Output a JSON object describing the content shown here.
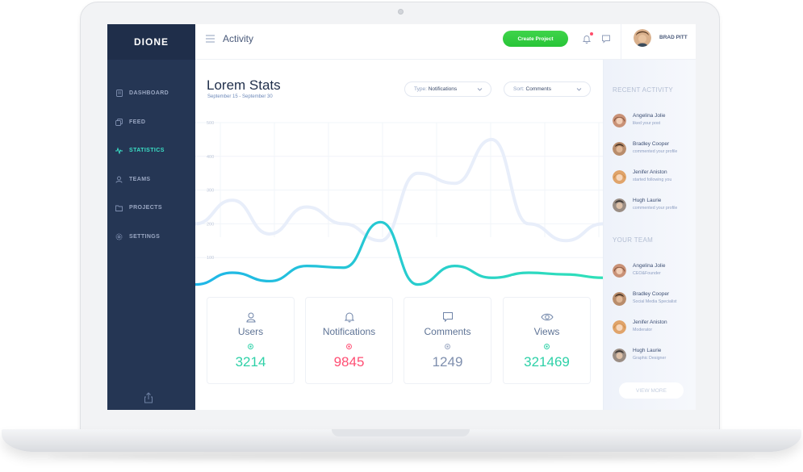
{
  "brand": {
    "name": "DIONE"
  },
  "sidebar": {
    "items": [
      {
        "label": "DASHBOARD",
        "icon": "file-icon",
        "active": false
      },
      {
        "label": "FEED",
        "icon": "copy-icon",
        "active": false
      },
      {
        "label": "STATISTICS",
        "icon": "pulse-icon",
        "active": true
      },
      {
        "label": "TEAMS",
        "icon": "user-icon",
        "active": false
      },
      {
        "label": "PROJECTS",
        "icon": "folder-icon",
        "active": false
      },
      {
        "label": "SETTINGS",
        "icon": "gear-icon",
        "active": false
      }
    ],
    "bottom_icon": "share-icon"
  },
  "header": {
    "title": "Activity",
    "create_label": "Create Project",
    "user_name": "BRAD PITT"
  },
  "main": {
    "title": "Lorem Stats",
    "subtitle": "September 15 - September 30",
    "type_filter": {
      "key": "Type:",
      "value": "Notifications"
    },
    "sort_filter": {
      "key": "Sort:",
      "value": "Comments"
    }
  },
  "chart_data": {
    "type": "line",
    "y_ticks": [
      "500",
      "400",
      "300",
      "200",
      "100"
    ],
    "ylim": [
      0,
      500
    ],
    "grid": true,
    "series": [
      {
        "values": [
          20,
          55,
          30,
          75,
          70,
          205,
          20,
          75,
          40,
          55,
          50,
          40
        ]
      },
      {
        "values": [
          200,
          270,
          170,
          250,
          200,
          150,
          350,
          320,
          450,
          200,
          150,
          200
        ]
      }
    ],
    "colors": {
      "primary_start": "#1fb6e8",
      "primary_end": "#2fe0b8",
      "secondary": "#e8eefa"
    }
  },
  "stats": [
    {
      "label": "Users",
      "value": "3214",
      "color": "#2fd1a8",
      "icon": "user-icon"
    },
    {
      "label": "Notifications",
      "value": "9845",
      "color": "#ff4f74",
      "icon": "bell-icon"
    },
    {
      "label": "Comments",
      "value": "1249",
      "color": "#7f8fae",
      "icon": "chat-icon"
    },
    {
      "label": "Views",
      "value": "321469",
      "color": "#2fd1a8",
      "icon": "eye-icon"
    }
  ],
  "recent_activity": {
    "title": "RECENT ACTIVITY",
    "items": [
      {
        "name": "Angelina Jolie",
        "desc": "liked your post"
      },
      {
        "name": "Bradley Cooper",
        "desc": "commented your profile"
      },
      {
        "name": "Jenifer Aniston",
        "desc": "started following you"
      },
      {
        "name": "Hugh Laurie",
        "desc": "commented your profile"
      }
    ]
  },
  "team": {
    "title": "YOUR TEAM",
    "items": [
      {
        "name": "Angelina Jolie",
        "desc": "CEO&Founder"
      },
      {
        "name": "Bradley Cooper",
        "desc": "Social Media Specialist"
      },
      {
        "name": "Jenifer Aniston",
        "desc": "Moderator"
      },
      {
        "name": "Hugh Laurie",
        "desc": "Graphic Designer"
      }
    ],
    "view_more_label": "VIEW MORE"
  }
}
